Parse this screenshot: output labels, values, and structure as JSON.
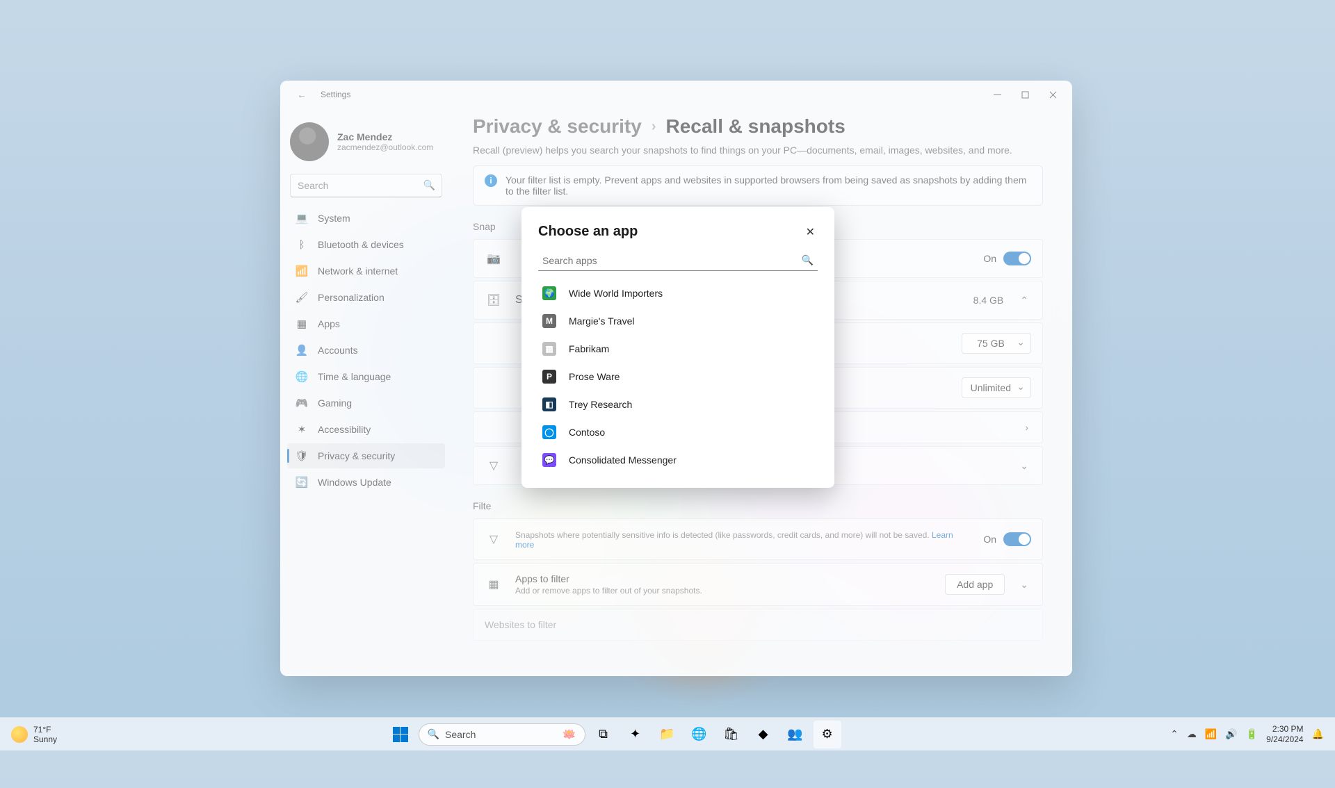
{
  "window": {
    "title": "Settings"
  },
  "profile": {
    "name": "Zac Mendez",
    "email": "zacmendez@outlook.com"
  },
  "sidebar": {
    "search_placeholder": "Search",
    "items": [
      {
        "label": "System",
        "icon": "💻"
      },
      {
        "label": "Bluetooth & devices",
        "icon": "ᛒ"
      },
      {
        "label": "Network & internet",
        "icon": "📶"
      },
      {
        "label": "Personalization",
        "icon": "🖌"
      },
      {
        "label": "Apps",
        "icon": "▦"
      },
      {
        "label": "Accounts",
        "icon": "👤"
      },
      {
        "label": "Time & language",
        "icon": "🌐"
      },
      {
        "label": "Gaming",
        "icon": "🎮"
      },
      {
        "label": "Accessibility",
        "icon": "✶"
      },
      {
        "label": "Privacy & security",
        "icon": "🛡"
      },
      {
        "label": "Windows Update",
        "icon": "🔄"
      }
    ],
    "active_index": 9
  },
  "breadcrumb": {
    "root": "Privacy & security",
    "leaf": "Recall & snapshots"
  },
  "intro": "Recall (preview) helps you search your snapshots to find things on your PC—documents, email, images, websites, and more.",
  "info_banner": "Your filter list is empty. Prevent apps and websites in supported browsers from being saved as snapshots by adding them to the filter list.",
  "sections": {
    "snap_heading_partial": "Snap",
    "save_toggle": {
      "state_label": "On"
    },
    "storage": {
      "heading_letter": "S",
      "used": "8.4 GB",
      "limit_value": "75 GB",
      "duration_value": "Unlimited"
    },
    "filter_heading_partial": "Filte",
    "sensitive": {
      "sub": "Snapshots where potentially sensitive info is detected (like passwords, credit cards, and more) will not be saved.",
      "learn": "Learn more",
      "state_label": "On"
    },
    "apps_filter": {
      "title": "Apps to filter",
      "sub": "Add or remove apps to filter out of your snapshots.",
      "button": "Add app"
    },
    "websites_filter_partial": "Websites to filter"
  },
  "modal": {
    "title": "Choose an app",
    "search_placeholder": "Search apps",
    "apps": [
      {
        "name": "Wide World Importers",
        "bg": "#2e9e44",
        "glyph": "🌍"
      },
      {
        "name": "Margie's Travel",
        "bg": "#6b6b6b",
        "glyph": "M"
      },
      {
        "name": "Fabrikam",
        "bg": "#bfbfbf",
        "glyph": "▦"
      },
      {
        "name": "Prose Ware",
        "bg": "#333333",
        "glyph": "P"
      },
      {
        "name": "Trey Research",
        "bg": "#1a3a5a",
        "glyph": "◧"
      },
      {
        "name": "Contoso",
        "bg": "#0091ea",
        "glyph": "◯"
      },
      {
        "name": "Consolidated Messenger",
        "bg": "#7b4dff",
        "glyph": "💬"
      }
    ]
  },
  "taskbar": {
    "weather": {
      "temp": "71°F",
      "cond": "Sunny"
    },
    "search_placeholder": "Search",
    "clock": {
      "time": "2:30 PM",
      "date": "9/24/2024"
    }
  }
}
